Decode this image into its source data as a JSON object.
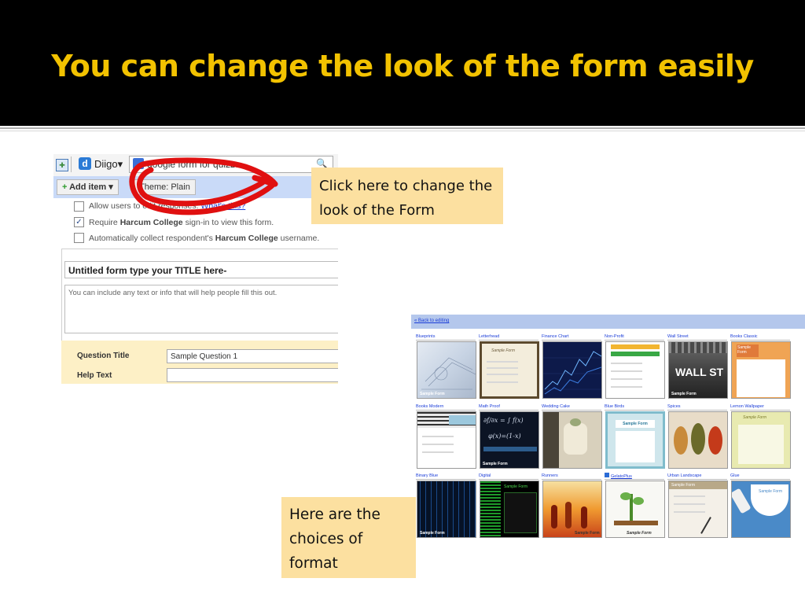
{
  "slide": {
    "title": "You can change the look of the form easily"
  },
  "browser_toolbar": {
    "diigo_label": "Diigo▾",
    "search_value": "google form for quizzs",
    "search_icon": "magnifier-icon"
  },
  "form_editor": {
    "add_item_label": "Add item ▾",
    "theme_label": "Theme:  Plain",
    "options": [
      {
        "checked": false,
        "text": "Allow users to edit responses.",
        "link": "What's this?"
      },
      {
        "checked": true,
        "text_pre": "Require",
        "bold": "Harcum College",
        "text_post": "sign-in to view this form."
      },
      {
        "checked": false,
        "text_pre": "Automatically collect respondent's",
        "bold": "Harcum College",
        "text_post": "username."
      }
    ],
    "form_title": "Untitled form type your TITLE here-",
    "form_description": "You can include any text or info that will help people fill this out.",
    "question_title_label": "Question Title",
    "question_title_value": "Sample Question 1",
    "help_text_label": "Help Text",
    "help_text_value": ""
  },
  "callouts": {
    "theme_hint": "Click here to change the look of the Form",
    "choices_hint": "Here are the choices of format"
  },
  "theme_gallery": {
    "back_link": "« Back to editing",
    "themes": [
      {
        "name": "Blueprints",
        "caption": "Sample Form"
      },
      {
        "name": "Letterhead",
        "caption": "Sample Form"
      },
      {
        "name": "Finance Chart",
        "caption": ""
      },
      {
        "name": "Non-Profit",
        "caption": ""
      },
      {
        "name": "Wall Street",
        "caption": "Sample Form",
        "overlay": "WALL ST"
      },
      {
        "name": "Books Classic",
        "caption": "Sample Form"
      },
      {
        "name": "Books Modern",
        "caption": ""
      },
      {
        "name": "Math Proof",
        "caption": "Sample Form"
      },
      {
        "name": "Wedding Cake",
        "caption": ""
      },
      {
        "name": "Blue Birds",
        "caption": "Sample Form"
      },
      {
        "name": "Spices",
        "caption": ""
      },
      {
        "name": "Lemon Wallpaper",
        "caption": "Sample Form"
      },
      {
        "name": "Binary Blue",
        "caption": "Sample Form"
      },
      {
        "name": "Digital",
        "caption": "Sample Form"
      },
      {
        "name": "Runners",
        "caption": "Sample Form"
      },
      {
        "name": "GelatoPlus",
        "caption": "Sample Form"
      },
      {
        "name": "Urban Landscape",
        "caption": "Sample Form"
      },
      {
        "name": "Glue",
        "caption": "Sample Form"
      }
    ]
  },
  "colors": {
    "title": "#f2c200",
    "callout": "#fce0a0",
    "annotation_stroke": "#e01010",
    "form_bar": "#c9daf8"
  }
}
